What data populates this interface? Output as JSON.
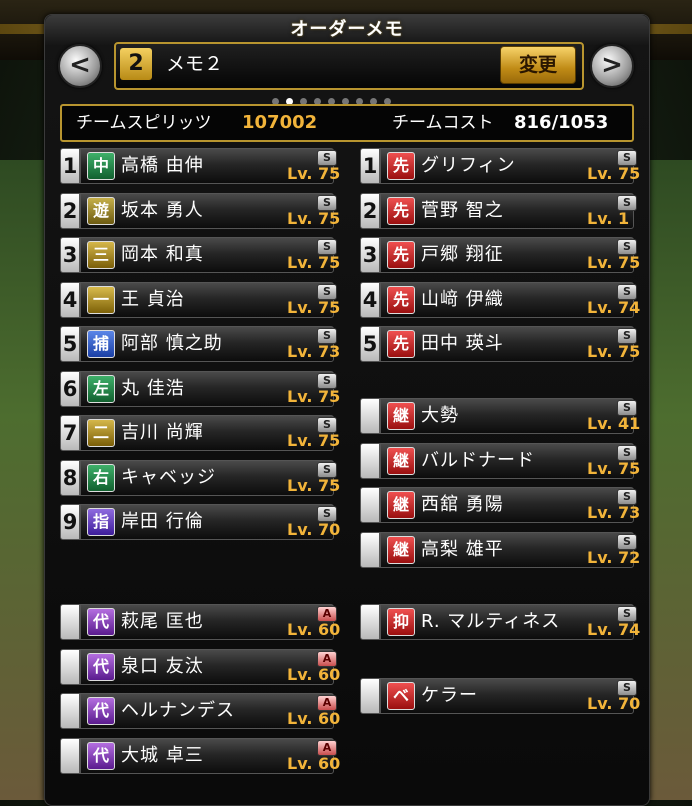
{
  "header": {
    "title": "オーダーメモ"
  },
  "memo": {
    "number": "2",
    "name": "メモ２",
    "change_label": "変更"
  },
  "nav": {
    "prev_glyph": "<",
    "next_glyph": ">"
  },
  "pager": {
    "count": 9,
    "active_index": 1
  },
  "team": {
    "spirits_label": "チームスピリッツ",
    "spirits_value": "107002",
    "cost_label": "チームコスト",
    "cost_value": "816/1053"
  },
  "batters": [
    {
      "slot": "1",
      "pos": "中",
      "name": "高橋 由伸",
      "rank": "S",
      "lv": "Lv. 75"
    },
    {
      "slot": "2",
      "pos": "遊",
      "name": "坂本 勇人",
      "rank": "S",
      "lv": "Lv. 75"
    },
    {
      "slot": "3",
      "pos": "三",
      "name": "岡本 和真",
      "rank": "S",
      "lv": "Lv. 75"
    },
    {
      "slot": "4",
      "pos": "一",
      "name": "王 貞治",
      "rank": "S",
      "lv": "Lv. 75"
    },
    {
      "slot": "5",
      "pos": "捕",
      "name": "阿部 慎之助",
      "rank": "S",
      "lv": "Lv. 73"
    },
    {
      "slot": "6",
      "pos": "左",
      "name": "丸 佳浩",
      "rank": "S",
      "lv": "Lv. 75"
    },
    {
      "slot": "7",
      "pos": "二",
      "name": "吉川 尚輝",
      "rank": "S",
      "lv": "Lv. 75"
    },
    {
      "slot": "8",
      "pos": "右",
      "name": "キャベッジ",
      "rank": "S",
      "lv": "Lv. 75"
    },
    {
      "slot": "9",
      "pos": "指",
      "name": "岸田 行倫",
      "rank": "S",
      "lv": "Lv. 70"
    }
  ],
  "bench": [
    {
      "slot": "",
      "pos": "代",
      "name": "萩尾 匡也",
      "rank": "A",
      "lv": "Lv. 60"
    },
    {
      "slot": "",
      "pos": "代",
      "name": "泉口 友汰",
      "rank": "A",
      "lv": "Lv. 60"
    },
    {
      "slot": "",
      "pos": "代",
      "name": "ヘルナンデス",
      "rank": "A",
      "lv": "Lv. 60"
    },
    {
      "slot": "",
      "pos": "代",
      "name": "大城 卓三",
      "rank": "A",
      "lv": "Lv. 60"
    }
  ],
  "starters": [
    {
      "slot": "1",
      "pos": "先",
      "name": "グリフィン",
      "rank": "S",
      "lv": "Lv. 75"
    },
    {
      "slot": "2",
      "pos": "先",
      "name": "菅野 智之",
      "rank": "S",
      "lv": "Lv. 1"
    },
    {
      "slot": "3",
      "pos": "先",
      "name": "戸郷 翔征",
      "rank": "S",
      "lv": "Lv. 75"
    },
    {
      "slot": "4",
      "pos": "先",
      "name": "山﨑 伊織",
      "rank": "S",
      "lv": "Lv. 74"
    },
    {
      "slot": "5",
      "pos": "先",
      "name": "田中 瑛斗",
      "rank": "S",
      "lv": "Lv. 75"
    }
  ],
  "relievers": [
    {
      "slot": "",
      "pos": "継",
      "name": "大勢",
      "rank": "S",
      "lv": "Lv. 41"
    },
    {
      "slot": "",
      "pos": "継",
      "name": "バルドナード",
      "rank": "S",
      "lv": "Lv. 75"
    },
    {
      "slot": "",
      "pos": "継",
      "name": "西舘 勇陽",
      "rank": "S",
      "lv": "Lv. 73"
    },
    {
      "slot": "",
      "pos": "継",
      "name": "高梨 雄平",
      "rank": "S",
      "lv": "Lv. 72"
    }
  ],
  "closer": [
    {
      "slot": "",
      "pos": "抑",
      "name": "R. マルティネス",
      "rank": "S",
      "lv": "Lv. 74"
    }
  ],
  "extra": [
    {
      "slot": "",
      "pos": "ベ",
      "name": "ケラー",
      "rank": "S",
      "lv": "Lv. 70"
    }
  ]
}
